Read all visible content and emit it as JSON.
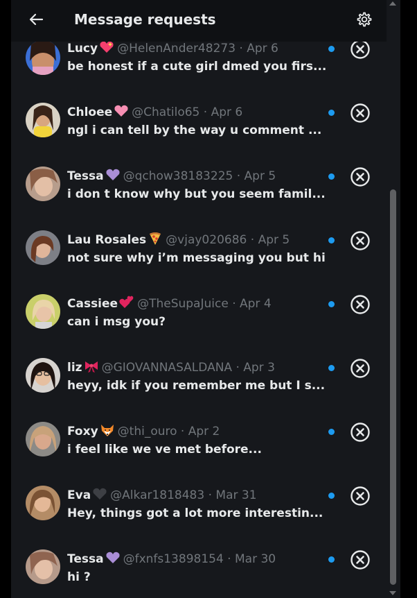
{
  "header": {
    "title": "Message requests",
    "back_icon": "back-arrow-icon",
    "settings_icon": "gear-icon"
  },
  "colors": {
    "background": "#16181c",
    "header": "#0f1114",
    "text_primary": "#e7e9ea",
    "text_secondary": "#71767b",
    "unread_dot": "#1d9bf0"
  },
  "requests": [
    {
      "name": "Lucy",
      "emoji": "sparkling-heart",
      "handle": "@HelenAnder48273",
      "sep": " · ",
      "date": "Apr 6",
      "preview": "be honest if a cute girl dmed you firs...",
      "unread": true
    },
    {
      "name": "Chloee",
      "emoji": "pink-heart",
      "handle": "@Chatilo65",
      "sep": " · ",
      "date": "Apr 6",
      "preview": "ngl i can tell by the way u comment ...",
      "unread": true
    },
    {
      "name": "Tessa",
      "emoji": "purple-heart",
      "handle": "@qchow38183225",
      "sep": " · ",
      "date": "Apr 5",
      "preview": "i don t know why but you seem famil...",
      "unread": true
    },
    {
      "name": "Lau Rosales",
      "emoji": "pizza",
      "handle": "@vjay020686",
      "sep": " · ",
      "date": "Apr 5",
      "preview": "not sure why i’m messaging you but hi",
      "unread": true
    },
    {
      "name": "Cassiee",
      "emoji": "two-hearts",
      "handle": "@TheSupaJuice",
      "sep": " · ",
      "date": "Apr 4",
      "preview": "can i msg you?",
      "unread": true
    },
    {
      "name": "liz",
      "emoji": "ribbon",
      "handle": "@GIOVANNASALDANA",
      "sep": " · ",
      "date": "Apr 3",
      "preview": "heyy, idk if you remember me but I s...",
      "unread": true
    },
    {
      "name": "Foxy",
      "emoji": "fox",
      "handle": "@thi_ouro",
      "sep": " · ",
      "date": "Apr 2",
      "preview": "i feel like we ve met before...",
      "unread": true
    },
    {
      "name": "Eva",
      "emoji": "black-heart",
      "handle": "@Alkar1818483",
      "sep": " · ",
      "date": "Mar 31",
      "preview": "Hey, things got a lot more interestin...",
      "unread": true
    },
    {
      "name": "Tessa",
      "emoji": "purple-heart",
      "handle": "@fxnfs13898154",
      "sep": " · ",
      "date": "Mar 30",
      "preview": "hi ?",
      "unread": true
    }
  ]
}
